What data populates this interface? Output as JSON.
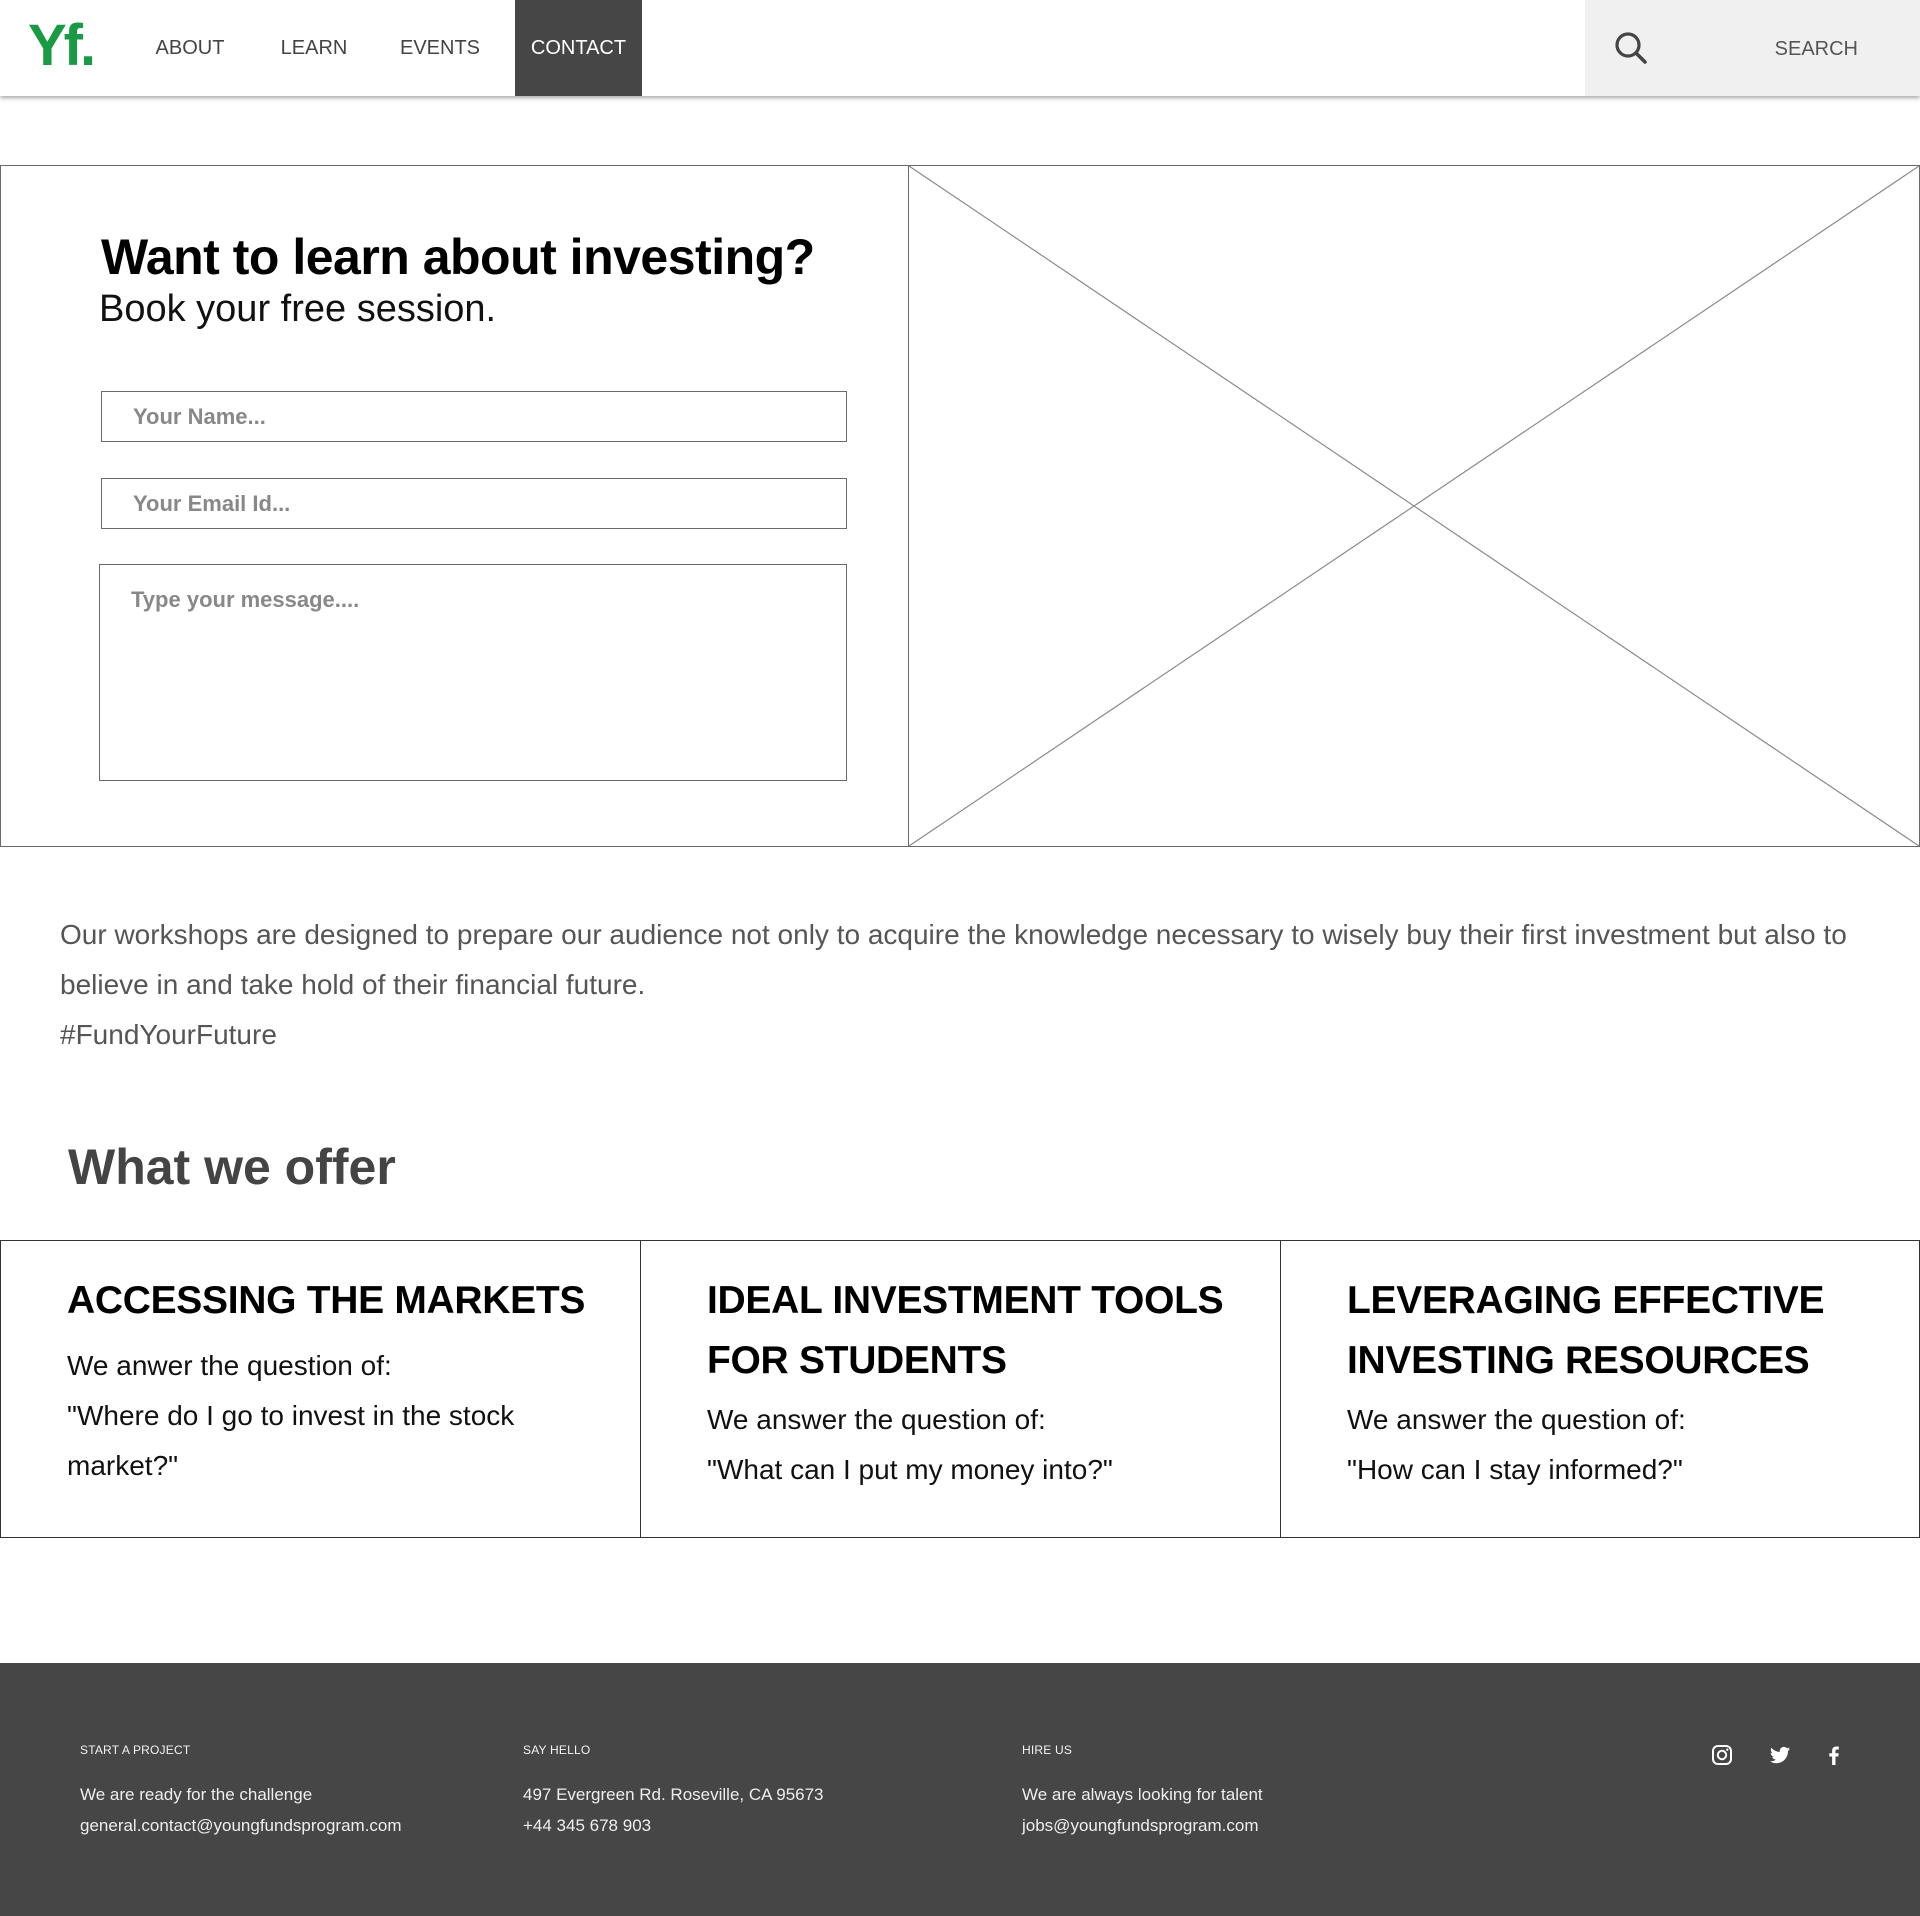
{
  "nav": {
    "logo_text": "Yf",
    "logo_dot": ".",
    "items": [
      {
        "label": "ABOUT"
      },
      {
        "label": "LEARN"
      },
      {
        "label": "EVENTS"
      },
      {
        "label": "CONTACT",
        "active": true
      }
    ],
    "search_label": "SEARCH",
    "search_icon": "search-icon"
  },
  "hero": {
    "title": "Want to learn about investing?",
    "subtitle": "Book your free session.",
    "name_placeholder": "Your Name...",
    "email_placeholder": "Your Email Id...",
    "message_placeholder": "Type your message....",
    "image": "image-placeholder"
  },
  "intro": {
    "paragraph": "Our workshops are designed to prepare our audience not only to acquire the knowledge necessary to wisely buy their first investment but also to believe in and take hold of their financial future.",
    "hashtag": "#FundYourFuture"
  },
  "offer": {
    "title": "What we offer",
    "cards": [
      {
        "title": "ACCESSING THE MARKETS",
        "line1": "We anwer the question of:",
        "line2": "\"Where do I go to invest in the stock market?\""
      },
      {
        "title": "IDEAL INVESTMENT TOOLS FOR STUDENTS",
        "line1": "We answer the question of:",
        "line2": "\"What can I put my money into?\""
      },
      {
        "title": "LEVERAGING EFFECTIVE INVESTING RESOURCES",
        "line1": "We answer the question of:",
        "line2": "\"How can I stay informed?\""
      }
    ]
  },
  "footer": {
    "columns": [
      {
        "heading": "START A PROJECT",
        "line1": "We are ready for the challenge",
        "line2": "general.contact@youngfundsprogram.com"
      },
      {
        "heading": "SAY HELLO",
        "line1": "497 Evergreen Rd. Roseville, CA 95673",
        "line2": "+44 345 678 903"
      },
      {
        "heading": "HIRE US",
        "line1": "We are always looking for talent",
        "line2": "jobs@youngfundsprogram.com"
      }
    ],
    "social_icons": [
      "instagram-icon",
      "twitter-icon",
      "facebook-icon"
    ]
  },
  "colors": {
    "brand_green": "#1a9a45",
    "nav_active_bg": "#464646",
    "footer_bg": "#464646",
    "search_bg": "#f0f0f0"
  }
}
